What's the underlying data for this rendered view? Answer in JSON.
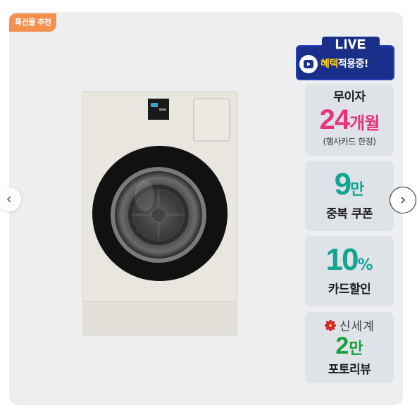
{
  "card": {
    "gift_tag": "특선물 추천"
  },
  "product": {
    "image_icon": "washing-machine-image"
  },
  "live": {
    "title": "LIVE",
    "text_highlight": "혜택",
    "text_rest": "적용중!"
  },
  "benefits": {
    "installment": {
      "top": "무이자",
      "number": "24",
      "unit": "개월",
      "note": "(행사카드 한정)"
    },
    "coupon": {
      "number": "9",
      "unit": "만",
      "label": "중복 쿠폰"
    },
    "card_discount": {
      "number": "10",
      "unit": "%",
      "label": "카드할인"
    },
    "review": {
      "brand": "신세계",
      "number": "2",
      "unit": "만",
      "label": "포토리뷰"
    }
  },
  "nav": {
    "prev_icon": "chevron-left-icon",
    "next_icon": "chevron-right-icon"
  },
  "colors": {
    "card_bg": "#eceef0",
    "tag": "#f4914f",
    "live_blue": "#1a2f8a",
    "pink": "#e8357a",
    "teal": "#12a594",
    "green": "#1a9e3a"
  }
}
